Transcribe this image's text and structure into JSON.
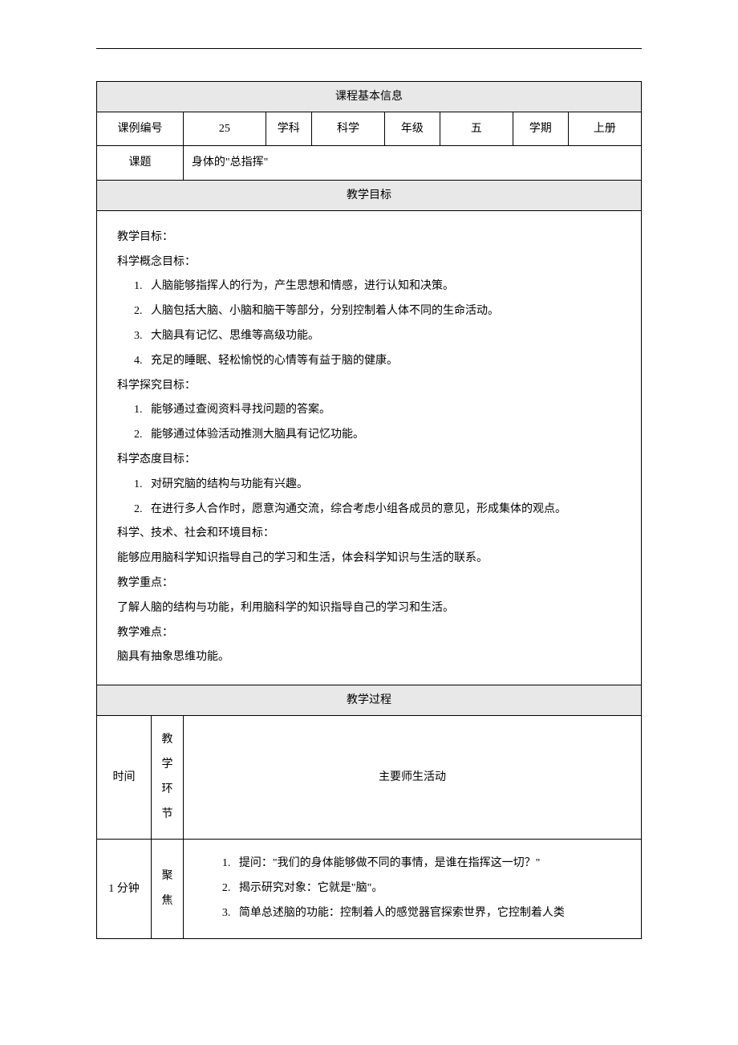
{
  "headers": {
    "basic_info": "课程基本信息",
    "objectives": "教学目标",
    "process": "教学过程"
  },
  "info": {
    "course_id_label": "课例编号",
    "course_id_value": "25",
    "subject_label": "学科",
    "subject_value": "科学",
    "grade_label": "年级",
    "grade_value": "五",
    "semester_label": "学期",
    "semester_value": "上册",
    "topic_label": "课题",
    "topic_value": "身体的\"总指挥\""
  },
  "objectives": {
    "title": "教学目标：",
    "concept_title": "科学概念目标：",
    "concept_items": [
      "人脑能够指挥人的行为，产生思想和情感，进行认知和决策。",
      "人脑包括大脑、小脑和脑干等部分，分别控制着人体不同的生命活动。",
      "大脑具有记忆、思维等高级功能。",
      "充足的睡眠、轻松愉悦的心情等有益于脑的健康。"
    ],
    "inquiry_title": "科学探究目标：",
    "inquiry_items": [
      "能够通过查阅资料寻找问题的答案。",
      "能够通过体验活动推测大脑具有记忆功能。"
    ],
    "attitude_title": "科学态度目标：",
    "attitude_items": [
      "对研究脑的结构与功能有兴趣。",
      "在进行多人合作时，愿意沟通交流，综合考虑小组各成员的意见，形成集体的观点。"
    ],
    "stse_title": "科学、技术、社会和环境目标：",
    "stse_text": "能够应用脑科学知识指导自己的学习和生活，体会科学知识与生活的联系。",
    "keypoint_title": "教学重点：",
    "keypoint_text": "了解人脑的结构与功能，利用脑科学的知识指导自己的学习和生活。",
    "difficulty_title": "教学难点：",
    "difficulty_text": "脑具有抽象思维功能。"
  },
  "process": {
    "col_time": "时间",
    "col_stage_chars": [
      "教",
      "学",
      "环",
      "节"
    ],
    "col_activity": "主要师生活动",
    "row1": {
      "time": "1 分钟",
      "stage": "聚焦",
      "items": [
        "提问：\"我们的身体能够做不同的事情，是谁在指挥这一切？\"",
        "揭示研究对象：它就是\"脑\"。",
        "简单总述脑的功能：控制着人的感觉器官探索世界，它控制着人类"
      ]
    }
  }
}
